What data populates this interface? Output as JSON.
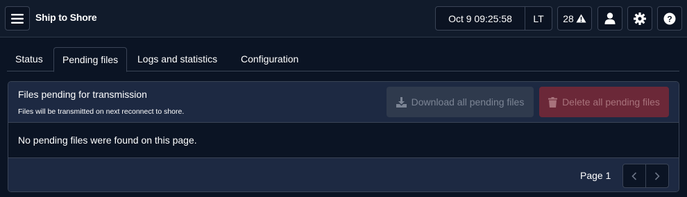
{
  "header": {
    "title": "Ship to Shore",
    "clock_time": "Oct 9 09:25:58",
    "timezone": "LT",
    "alert_count": "28",
    "icons": {
      "menu": "hamburger-icon",
      "alert": "warning-icon",
      "user": "user-icon",
      "settings": "gear-icon",
      "help": "help-icon"
    }
  },
  "tabs": [
    {
      "label": "Status"
    },
    {
      "label": "Pending files",
      "active": true
    },
    {
      "label": "Logs and statistics"
    },
    {
      "label": "Configuration"
    }
  ],
  "panel": {
    "title": "Files pending for transmission",
    "subtitle": "Files will be transmitted on next reconnect to shore.",
    "download_label": "Download all pending files",
    "delete_label": "Delete all pending files",
    "empty_message": "No pending files were found on this page.",
    "page_label": "Page 1"
  },
  "colors": {
    "background": "#0b1424",
    "delete_accent": "#6b2838",
    "download_bg": "#2f3a4d"
  }
}
